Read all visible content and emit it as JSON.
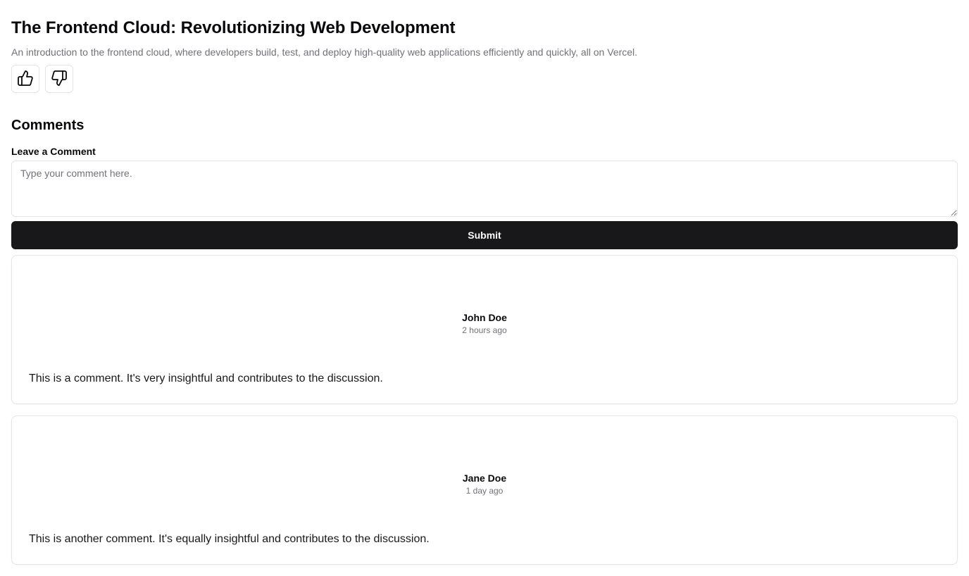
{
  "article": {
    "title": "The Frontend Cloud: Revolutionizing Web Development",
    "description": "An introduction to the frontend cloud, where developers build, test, and deploy high-quality web applications efficiently and quickly, all on Vercel."
  },
  "votes": {
    "like_icon": "thumbs-up-icon",
    "dislike_icon": "thumbs-down-icon"
  },
  "comments_section": {
    "heading": "Comments",
    "form": {
      "label": "Leave a Comment",
      "placeholder": "Type your comment here.",
      "value": "",
      "submit_label": "Submit"
    },
    "comments": [
      {
        "author": "John Doe",
        "time": "2 hours ago",
        "text": "This is a comment. It's very insightful and contributes to the discussion."
      },
      {
        "author": "Jane Doe",
        "time": "1 day ago",
        "text": "This is another comment. It's equally insightful and contributes to the discussion."
      }
    ]
  },
  "colors": {
    "primary_button": "#18181b",
    "muted_text": "#71717a",
    "border": "#e4e4e7"
  }
}
